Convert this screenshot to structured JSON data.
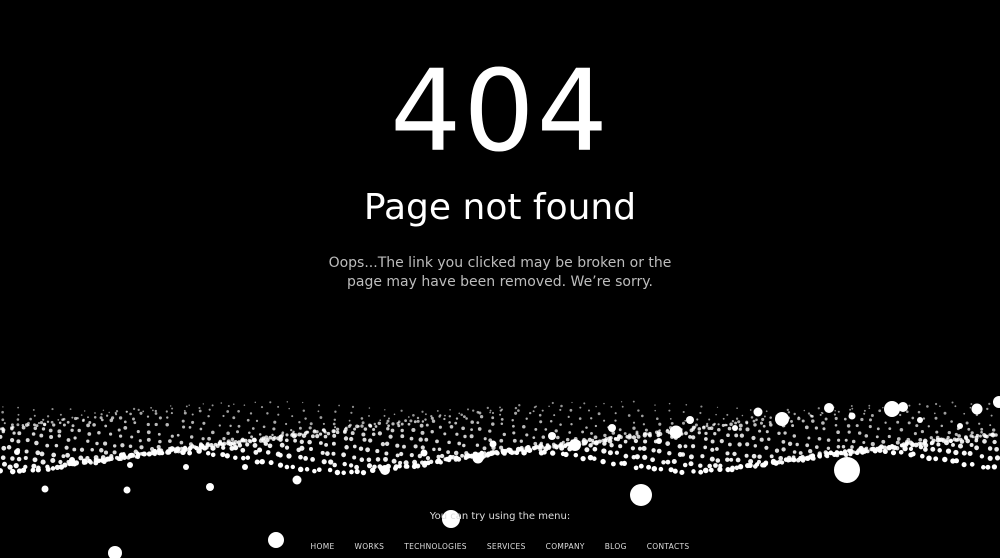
{
  "error": {
    "code": "404",
    "title": "Page not found",
    "message": "Oops...The link you clicked may be broken or the page may have been removed. We’re sorry."
  },
  "footer": {
    "hint": "You can try using the menu:",
    "menu": [
      {
        "label": "HOME"
      },
      {
        "label": "WORKS"
      },
      {
        "label": "TECHNOLOGIES"
      },
      {
        "label": "SERVICES"
      },
      {
        "label": "COMPANY"
      },
      {
        "label": "BLOG"
      },
      {
        "label": "CONTACTS"
      }
    ]
  },
  "colors": {
    "background": "#000000",
    "text": "#ffffff",
    "muted_text": "#bdbdbd"
  }
}
